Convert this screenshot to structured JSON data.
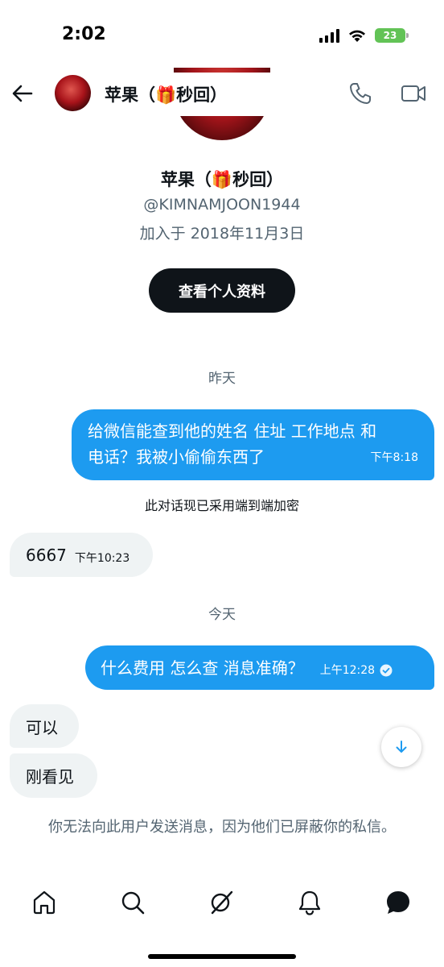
{
  "status_bar": {
    "time": "2:02",
    "battery": "23"
  },
  "header": {
    "title_prefix": "苹果（",
    "gift_emoji": "🎁",
    "title_suffix": "秒回）"
  },
  "profile": {
    "name_prefix": "苹果（",
    "gift_emoji": "🎁",
    "name_suffix": "秒回）",
    "handle": "@KIMNAMJOON1944",
    "joined": "加入于 2018年11月3日",
    "view_profile_label": "查看个人资料"
  },
  "conversation": {
    "date_yesterday": "昨天",
    "msg1": {
      "line1": "给微信能查到他的姓名 住址 工作地点 和",
      "line2": "电话？我被小偷偷东西了",
      "time": "下午8:18"
    },
    "encryption_notice": "此对话现已采用端到端加密",
    "msg2": {
      "text": "6667",
      "time": "下午10:23"
    },
    "date_today": "今天",
    "msg3": {
      "text": "什么费用 怎么查 消息准确？",
      "time": "上午12:28"
    },
    "msg4": {
      "text": "可以"
    },
    "msg5": {
      "text": "刚看见"
    }
  },
  "blocked_notice": "你无法向此用户发送消息，因为他们已屏蔽你的私信。",
  "colors": {
    "accent": "#1d9bf0",
    "incoming_bubble": "#eff3f4",
    "text_primary": "#0f1419",
    "text_secondary": "#536471"
  },
  "bottom_nav": {
    "icons": [
      "home-icon",
      "search-icon",
      "grok-icon",
      "bell-icon",
      "messages-icon"
    ]
  }
}
